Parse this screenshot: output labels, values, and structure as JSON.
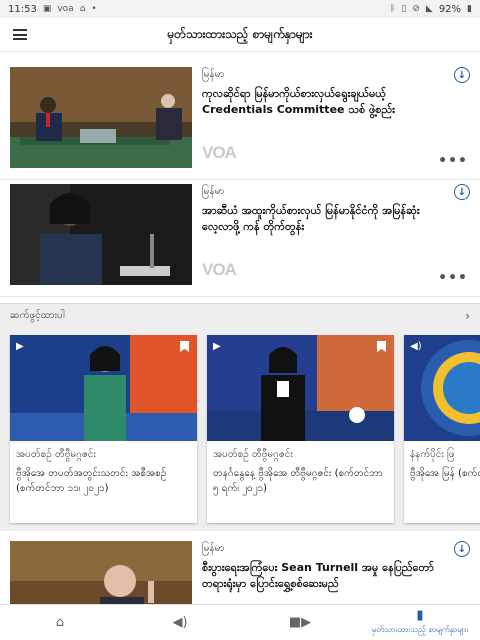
{
  "status": {
    "time": "11:53",
    "battery": "92%",
    "icons_left": [
      "image-icon",
      "voa-icon",
      "home-icon",
      "dot-icon"
    ],
    "icons_right": [
      "bluetooth-icon",
      "vibrate-icon",
      "dnd-icon",
      "wifi-icon",
      "battery-icon"
    ]
  },
  "appbar": {
    "title": "မှတ်သားထားသည့် စာမျက်နှာများ"
  },
  "articles": [
    {
      "category": "မြန်မာ",
      "headline": "ကုလဆိုင်ရာ မြန်မာကိုယ်စားလှယ်ရွေးချယ်မယ့် Credentials Committee သစ် ဖွဲ့စည်း",
      "logo": "VOA"
    },
    {
      "category": "မြန်မာ",
      "headline": "အာဆီယံ အထူးကိုယ်စားလှယ် မြန်မာနိုင်ငံကို အမြန်ဆုံး လေ့လာဖို့ ကန် တိုက်တွန်း",
      "logo": "VOA"
    }
  ],
  "section": {
    "title": "ဆက်ဖွင့်ထားပါ",
    "chevron": "›"
  },
  "cards": [
    {
      "category": "အပတ်စဉ် တီဗွီမဂ္ဂဇင်း",
      "title": "ဗွီအိုအေ တပတ်အတွင်းသတင်း အစီအစဉ် (စက်တင်ဘာ ၁၁၊ ၂၀၂၁)",
      "media": "video-icon"
    },
    {
      "category": "အပတ်စဉ် တီဗွီမဂ္ဂဇင်း",
      "title": "တနင်္ဂနွေနေ့ ဗွီအိုအေ တီဗွီမဂ္ဂဇင်း (စက်တင်ဘာ ၅ ရက်၊ ၂၀၂၁)",
      "media": "video-icon"
    },
    {
      "category": "နံနက်ပိုင်း ဖြ",
      "title": "ဗွီအိုအေ မြန် (စက်တင်",
      "media": "audio-icon"
    }
  ],
  "last_article": {
    "category": "မြန်မာ",
    "headline": "စီးပွားရေးအကြံပေး Sean Turnell အမှု နေပြည်တော်တရားရုံးမှာ ပြောင်းရွှေ့စစ်ဆေးမည်"
  },
  "nav": {
    "items": [
      {
        "label": "",
        "icon": "home-icon"
      },
      {
        "label": "",
        "icon": "audio-icon"
      },
      {
        "label": "",
        "icon": "video-icon"
      },
      {
        "label": "မှတ်သားထားသည့် စာမျက်နှာများ",
        "icon": "bookmark-icon"
      }
    ]
  },
  "colors": {
    "accent": "#1f5fa8",
    "voa_gray": "#c9c9c9",
    "section_bg": "#eeeeee"
  }
}
